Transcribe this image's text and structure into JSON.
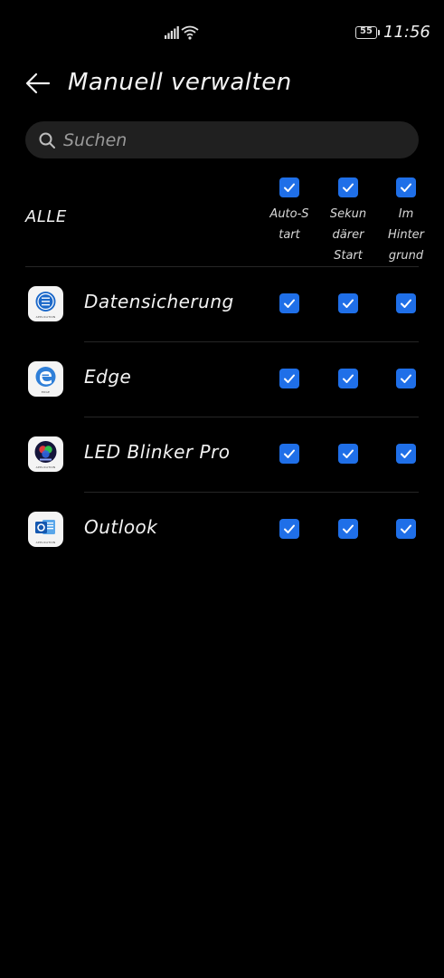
{
  "status_bar": {
    "battery_level": "55",
    "time": "11:56",
    "icons": [
      "signal-icon",
      "wifi-icon",
      "battery-icon"
    ]
  },
  "header": {
    "title": "Manuell verwalten",
    "back_icon": "arrow-left-icon"
  },
  "search": {
    "placeholder": "Suchen",
    "value": ""
  },
  "columns": {
    "all_label": "ALLE",
    "headers": [
      {
        "label": "Auto-S\ntart",
        "checked": true
      },
      {
        "label": "Sekun\ndärer\nStart",
        "checked": true
      },
      {
        "label": "Im\nHinter\ngrund",
        "checked": true
      }
    ]
  },
  "apps": [
    {
      "name": "Datensicherung",
      "icon": "datensicherung-app-icon",
      "icon_caption": "APPLICATION",
      "auto_start": true,
      "secondary_start": true,
      "background": true
    },
    {
      "name": "Edge",
      "icon": "edge-app-icon",
      "icon_caption": "EDGE",
      "auto_start": true,
      "secondary_start": true,
      "background": true
    },
    {
      "name": "LED Blinker Pro",
      "icon": "led-blinker-app-icon",
      "icon_caption": "APPLICATION",
      "auto_start": true,
      "secondary_start": true,
      "background": true
    },
    {
      "name": "Outlook",
      "icon": "outlook-app-icon",
      "icon_caption": "APPLICATION",
      "auto_start": true,
      "secondary_start": true,
      "background": true
    }
  ],
  "colors": {
    "background": "#000000",
    "checkbox_accent": "#1f6fe8",
    "search_bg": "#202020"
  }
}
